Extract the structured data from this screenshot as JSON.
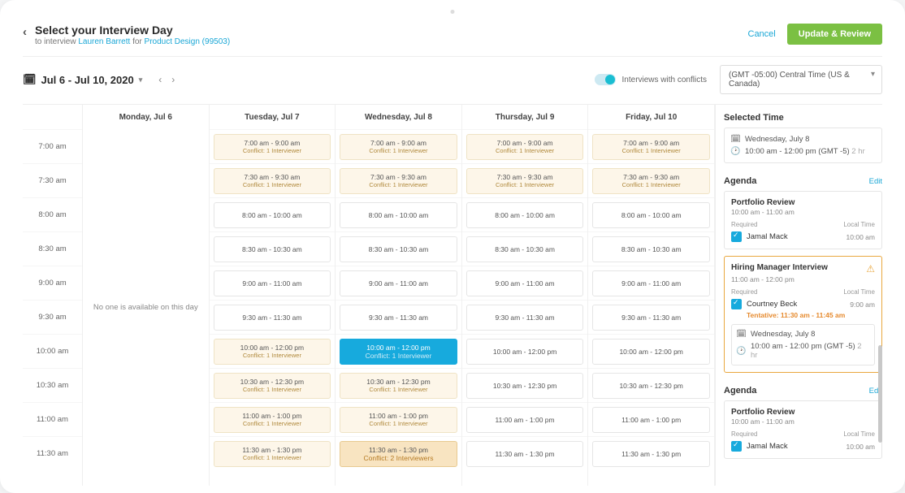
{
  "header": {
    "title": "Select your Interview Day",
    "subtitle_prefix": "to interview ",
    "candidate": "Lauren Barrett",
    "subtitle_for": " for ",
    "job": "Product Design (99503)",
    "cancel": "Cancel",
    "primary_btn": "Update & Review"
  },
  "toolbar": {
    "date_range": "Jul 6 - Jul 10, 2020",
    "toggle_label": "Interviews with conflicts",
    "timezone": "(GMT -05:00) Central Time (US & Canada)"
  },
  "times": [
    "7:00 am",
    "7:30 am",
    "8:00 am",
    "8:30 am",
    "9:00 am",
    "9:30 am",
    "10:00 am",
    "10:30 am",
    "11:00 am",
    "11:30 am"
  ],
  "days": [
    "Monday, Jul 6",
    "Tuesday, Jul 7",
    "Wednesday, Jul 8",
    "Thursday, Jul 9",
    "Friday, Jul 10"
  ],
  "monday_empty": "No one is available on this day",
  "conflict_suffix": "Conflict: 1 Interviewer",
  "conflict_suffix_2": "Conflict: 2 Interviewers",
  "slots": {
    "r0": "7:00 am - 9:00 am",
    "r1": "7:30 am - 9:30 am",
    "r2": "8:00 am - 10:00 am",
    "r3": "8:30 am - 10:30 am",
    "r4": "9:00 am - 11:00 am",
    "r5": "9:30 am - 11:30 am",
    "r6": "10:00 am - 12:00 pm",
    "r7": "10:30 am - 12:30 pm",
    "r8": "11:00 am - 1:00 pm",
    "r9": "11:30 am - 1:30 pm"
  },
  "side": {
    "selected_title": "Selected Time",
    "selected_date": "Wednesday, July 8",
    "selected_time": "10:00 am - 12:00 pm (GMT -5) ",
    "selected_dur": "2 hr",
    "agenda_title": "Agenda",
    "edit": "Edit",
    "a1": {
      "title": "Portfolio Review",
      "time": "10:00 am - 11:00 am",
      "required": "Required",
      "local": "Local Time",
      "person": "Jamal Mack",
      "ptime": "10:00 am"
    },
    "a2": {
      "title": "Hiring Manager Interview",
      "time": "11:00 am - 12:00 pm",
      "required": "Required",
      "local": "Local Time",
      "person": "Courtney Beck",
      "ptime": "9:00 am",
      "tentative": "Tentative: 11:30 am - 11:45 am",
      "inner_date": "Wednesday, July 8",
      "inner_time": "10:00 am - 12:00 pm (GMT -5) ",
      "inner_dur": "2 hr"
    },
    "a3": {
      "title": "Portfolio Review",
      "time": "10:00 am - 11:00 am",
      "required": "Required",
      "local": "Local Time",
      "person": "Jamal Mack",
      "ptime": "10:00 am"
    }
  }
}
